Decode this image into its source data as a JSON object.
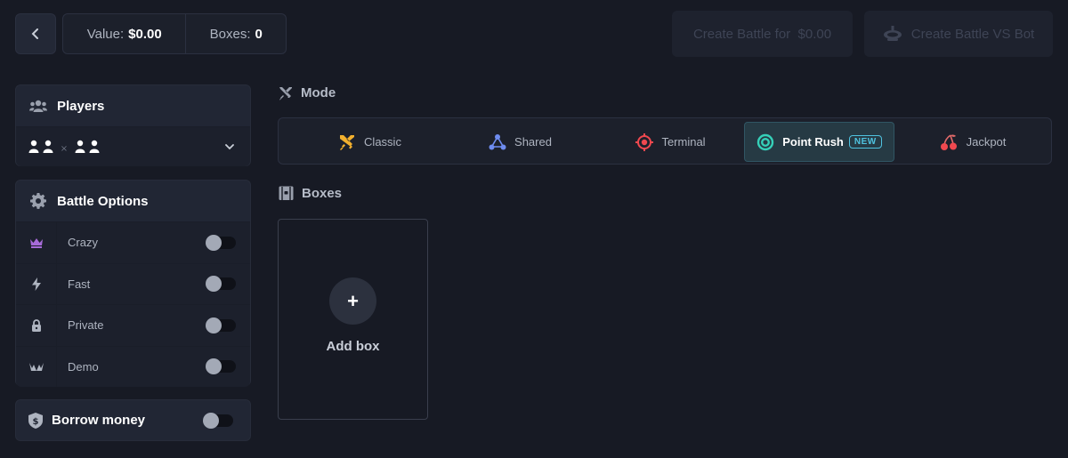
{
  "header": {
    "value_label": "Value:",
    "value_amount": "$0.00",
    "boxes_label": "Boxes:",
    "boxes_count": "0",
    "create_battle_label": "Create Battle for  $0.00",
    "create_bot_label": "Create Battle VS Bot"
  },
  "players": {
    "title": "Players",
    "separator": "×"
  },
  "battle_options": {
    "title": "Battle Options",
    "items": [
      {
        "label": "Crazy",
        "icon": "crown-icon",
        "enabled": false
      },
      {
        "label": "Fast",
        "icon": "lightning-icon",
        "enabled": false
      },
      {
        "label": "Private",
        "icon": "lock-icon",
        "enabled": false
      },
      {
        "label": "Demo",
        "icon": "demo-icon",
        "enabled": false
      }
    ]
  },
  "borrow": {
    "label": "Borrow money",
    "enabled": false
  },
  "mode": {
    "title": "Mode",
    "items": [
      {
        "label": "Classic",
        "icon": "swords-icon",
        "active": false
      },
      {
        "label": "Shared",
        "icon": "share-icon",
        "active": false
      },
      {
        "label": "Terminal",
        "icon": "target-icon",
        "active": false
      },
      {
        "label": "Point Rush",
        "icon": "ring-icon",
        "active": true,
        "badge": "NEW"
      },
      {
        "label": "Jackpot",
        "icon": "cherry-icon",
        "active": false
      }
    ]
  },
  "boxes": {
    "title": "Boxes",
    "add_label": "Add box",
    "add_symbol": "+"
  },
  "colors": {
    "background": "#171a24",
    "panel": "#212634",
    "accent_active": "#4fc3e0",
    "crazy_icon": "#a66bd8",
    "classic_icon": "#f2b02e",
    "shared_icon": "#6e8cf0",
    "terminal_icon": "#f0484f",
    "point_rush_icon": "#35d0b8",
    "jackpot_icon": "#f0484f"
  }
}
